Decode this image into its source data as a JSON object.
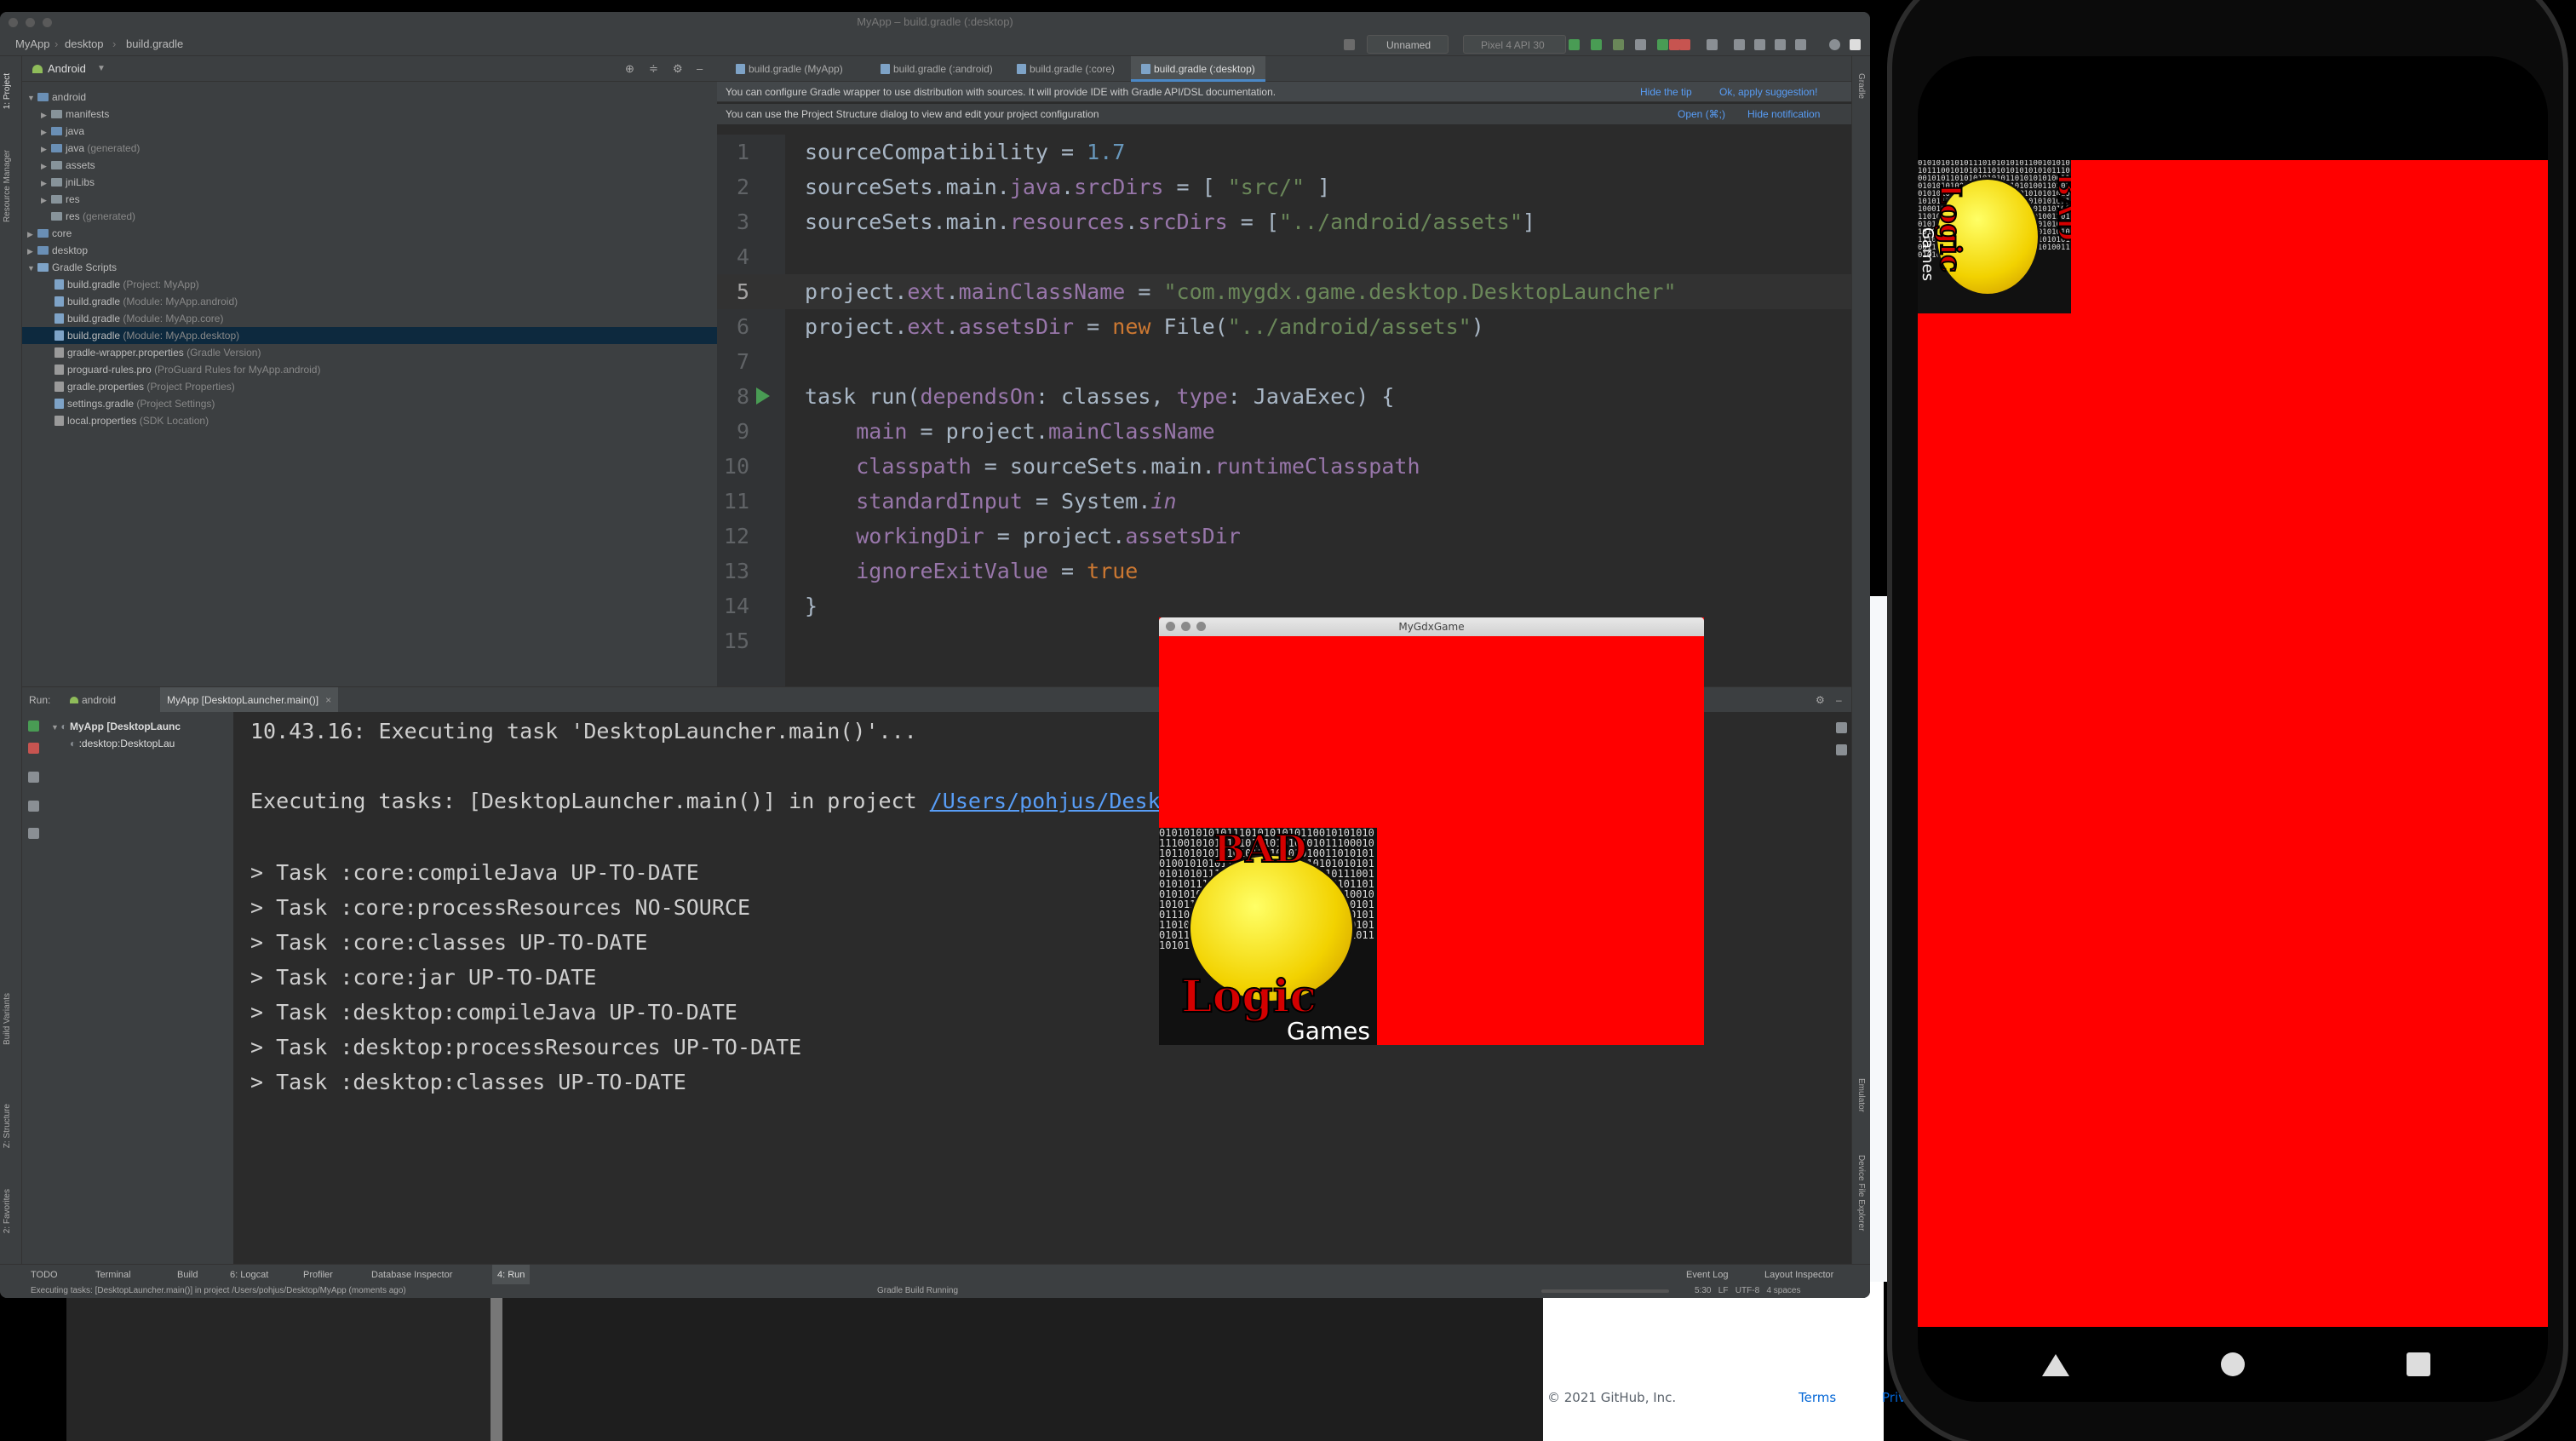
{
  "ide": {
    "window_title": "MyApp – build.gradle (:desktop)",
    "breadcrumbs": [
      "MyApp",
      "desktop",
      "build.gradle"
    ],
    "run_config": "Unnamed",
    "device": "Pixel 4 API 30",
    "project_view": "Android",
    "left_strip": [
      "1: Project",
      "Resource Manager",
      "Build Variants",
      "Z: Structure",
      "2: Favorites"
    ],
    "right_strip": [
      "Gradle",
      "Emulator",
      "Device File Explorer"
    ],
    "tree": [
      {
        "label": "android",
        "hint": "",
        "type": "module"
      },
      {
        "label": "manifests",
        "hint": "",
        "type": "folder"
      },
      {
        "label": "java",
        "hint": "",
        "type": "folder"
      },
      {
        "label": "java",
        "hint": "(generated)",
        "type": "folder"
      },
      {
        "label": "assets",
        "hint": "",
        "type": "folder"
      },
      {
        "label": "jniLibs",
        "hint": "",
        "type": "folder"
      },
      {
        "label": "res",
        "hint": "",
        "type": "folder"
      },
      {
        "label": "res",
        "hint": "(generated)",
        "type": "folder"
      },
      {
        "label": "core",
        "hint": "",
        "type": "module"
      },
      {
        "label": "desktop",
        "hint": "",
        "type": "module"
      },
      {
        "label": "Gradle Scripts",
        "hint": "",
        "type": "folder"
      },
      {
        "label": "build.gradle",
        "hint": "(Project: MyApp)",
        "type": "gradle"
      },
      {
        "label": "build.gradle",
        "hint": "(Module: MyApp.android)",
        "type": "gradle"
      },
      {
        "label": "build.gradle",
        "hint": "(Module: MyApp.core)",
        "type": "gradle"
      },
      {
        "label": "build.gradle",
        "hint": "(Module: MyApp.desktop)",
        "type": "gradle"
      },
      {
        "label": "gradle-wrapper.properties",
        "hint": "(Gradle Version)",
        "type": "gradle"
      },
      {
        "label": "proguard-rules.pro",
        "hint": "(ProGuard Rules for MyApp.android)",
        "type": "gradle"
      },
      {
        "label": "gradle.properties",
        "hint": "(Project Properties)",
        "type": "gradle"
      },
      {
        "label": "settings.gradle",
        "hint": "(Project Settings)",
        "type": "gradle"
      },
      {
        "label": "local.properties",
        "hint": "(SDK Location)",
        "type": "gradle"
      }
    ],
    "tabs": [
      "build.gradle (MyApp)",
      "build.gradle (:android)",
      "build.gradle (:core)",
      "build.gradle (:desktop)"
    ],
    "banner1": {
      "text": "You can configure Gradle wrapper to use distribution with sources. It will provide IDE with Gradle API/DSL documentation.",
      "link1": "Hide the tip",
      "link2": "Ok, apply suggestion!"
    },
    "banner2": {
      "text": "You can use the Project Structure dialog to view and edit your project configuration",
      "link1": "Open (⌘;)",
      "link2": "Hide notification"
    },
    "code_lines": [
      {
        "n": "1",
        "text": "sourceCompatibility = 1.7"
      },
      {
        "n": "2",
        "text": "sourceSets.main.java.srcDirs = [ \"src/\" ]"
      },
      {
        "n": "3",
        "text": "sourceSets.main.resources.srcDirs = [\"../android/assets\"]"
      },
      {
        "n": "4",
        "text": ""
      },
      {
        "n": "5",
        "text": "project.ext.mainClassName = \"com.mygdx.game.desktop.DesktopLauncher\""
      },
      {
        "n": "6",
        "text": "project.ext.assetsDir = new File(\"../android/assets\")"
      },
      {
        "n": "7",
        "text": ""
      },
      {
        "n": "8",
        "text": "task run(dependsOn: classes, type: JavaExec) {"
      },
      {
        "n": "9",
        "text": "    main = project.mainClassName"
      },
      {
        "n": "10",
        "text": "    classpath = sourceSets.main.runtimeClasspath"
      },
      {
        "n": "11",
        "text": "    standardInput = System.in"
      },
      {
        "n": "12",
        "text": "    workingDir = project.assetsDir"
      },
      {
        "n": "13",
        "text": "    ignoreExitValue = true"
      },
      {
        "n": "14",
        "text": "}"
      },
      {
        "n": "15",
        "text": ""
      }
    ],
    "run": {
      "label": "Run:",
      "tab1": "android",
      "tab2": "MyApp [DesktopLauncher.main()]",
      "tree1": "MyApp [DesktopLaunc",
      "tree2": ":desktop:DesktopLau"
    },
    "console": {
      "line1": "10.43.16: Executing task 'DesktopLauncher.main()'...",
      "line2_prefix": "Executing tasks: [DesktopLauncher.main()] in project ",
      "line2_link": "/Users/pohjus/Desktop/MyApp",
      "tasks": [
        "> Task :core:compileJava UP-TO-DATE",
        "> Task :core:processResources NO-SOURCE",
        "> Task :core:classes UP-TO-DATE",
        "> Task :core:jar UP-TO-DATE",
        "> Task :desktop:compileJava UP-TO-DATE",
        "> Task :desktop:processResources UP-TO-DATE",
        "> Task :desktop:classes UP-TO-DATE"
      ]
    },
    "bottom_tabs": [
      "TODO",
      "Terminal",
      "Build",
      "6: Logcat",
      "Profiler",
      "Database Inspector",
      "4: Run"
    ],
    "bottom_right": [
      "Event Log",
      "Layout Inspector"
    ],
    "status_left": "Executing tasks: [DesktopLauncher.main()] in project /Users/pohjus/Desktop/MyApp (moments ago)",
    "status_center": "Gradle Build Running",
    "status_right": "5:30   LF   UTF-8   4 spaces"
  },
  "gdx_window": {
    "title": "MyGdxGame"
  },
  "logo": {
    "word1": "BAD",
    "word2": "Logic",
    "word3": "Games",
    "bits": "01010101010111010101010110010101010111001010101110101010101010111000101011010101010101101010101001101010101001010101110101010011010101010101010101011101010101010101010101110010101011101010101010101110001010110101010101011010101010011010101010010101011101010100110101010101010101010111010101010101010101011100101010111010101010101011100010101101010101010110101010100110101010100101010111010101001101010101"
  },
  "github_footer": {
    "copyright": "© 2021 GitHub, Inc.",
    "terms": "Terms",
    "privacy": "Privacy"
  },
  "colors": {
    "game_background": "#ff0000",
    "ide_background": "#2b2b2b",
    "accent": "#4a88c7"
  }
}
